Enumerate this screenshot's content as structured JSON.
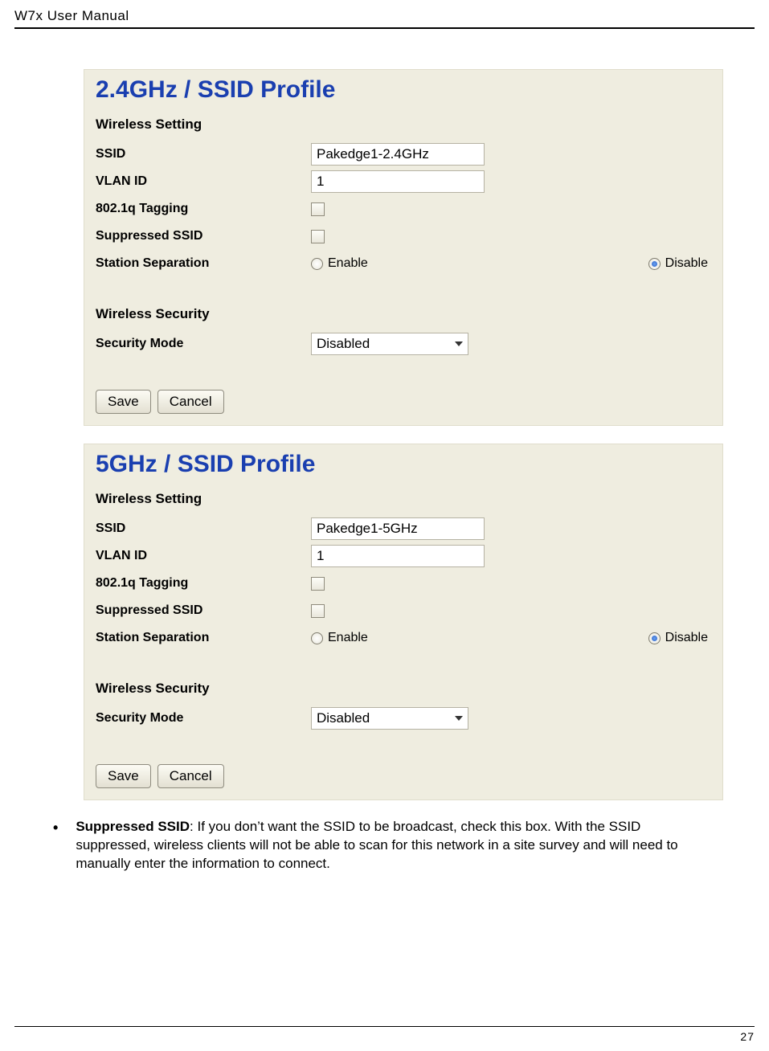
{
  "header": {
    "title": "W7x  User Manual"
  },
  "panels": [
    {
      "title": "2.4GHz / SSID Profile",
      "wireless_setting_heading": "Wireless Setting",
      "rows": {
        "ssid": {
          "label": "SSID",
          "value": "Pakedge1-2.4GHz"
        },
        "vlan": {
          "label": "VLAN ID",
          "value": "1"
        },
        "tag": {
          "label": "802.1q Tagging",
          "checked": false
        },
        "sup": {
          "label": "Suppressed SSID",
          "checked": false
        },
        "sep": {
          "label": "Station Separation",
          "enable_label": "Enable",
          "disable_label": "Disable",
          "selected": "disable"
        }
      },
      "security_heading": "Wireless Security",
      "security_mode": {
        "label": "Security Mode",
        "value": "Disabled"
      },
      "buttons": {
        "save": "Save",
        "cancel": "Cancel"
      }
    },
    {
      "title": "5GHz / SSID Profile",
      "wireless_setting_heading": "Wireless Setting",
      "rows": {
        "ssid": {
          "label": "SSID",
          "value": "Pakedge1-5GHz"
        },
        "vlan": {
          "label": "VLAN ID",
          "value": "1"
        },
        "tag": {
          "label": "802.1q Tagging",
          "checked": false
        },
        "sup": {
          "label": "Suppressed SSID",
          "checked": false
        },
        "sep": {
          "label": "Station Separation",
          "enable_label": "Enable",
          "disable_label": "Disable",
          "selected": "disable"
        }
      },
      "security_heading": "Wireless Security",
      "security_mode": {
        "label": "Security Mode",
        "value": "Disabled"
      },
      "buttons": {
        "save": "Save",
        "cancel": "Cancel"
      }
    }
  ],
  "bullet": {
    "bold": "Suppressed SSID",
    "text": ": If you don’t want the SSID to be broadcast, check this box. With the SSID suppressed, wireless clients will not be able to scan for this network in a site survey and will need to manually enter the information to connect."
  },
  "footer": {
    "page": "27"
  }
}
